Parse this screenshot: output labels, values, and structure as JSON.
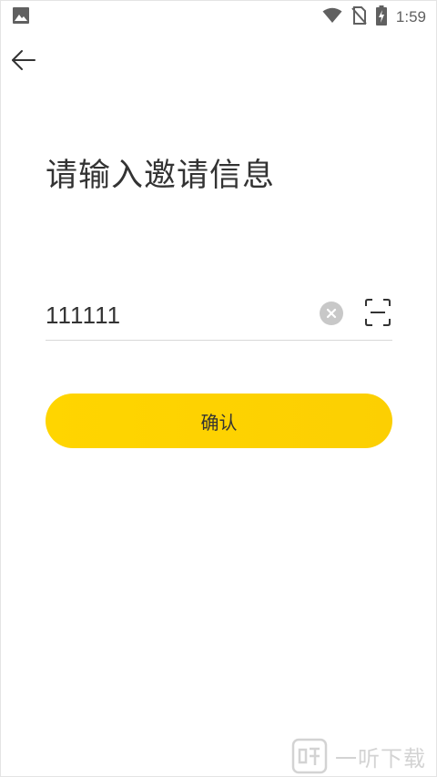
{
  "status_bar": {
    "time": "1:59",
    "left_icon": "gallery-icon",
    "icons": [
      "wifi-icon",
      "no-sim-icon",
      "battery-charging-icon"
    ]
  },
  "nav": {
    "back_icon": "back-arrow-icon"
  },
  "page": {
    "title": "请输入邀请信息"
  },
  "invite_input": {
    "value": "111111",
    "clear_icon": "clear-icon",
    "scan_icon": "scan-icon"
  },
  "confirm_button": {
    "label": "确认"
  },
  "watermark": {
    "text": "一听下载"
  },
  "colors": {
    "accent": "#ffd500",
    "title": "#333333",
    "divider": "#d8d8d8"
  }
}
